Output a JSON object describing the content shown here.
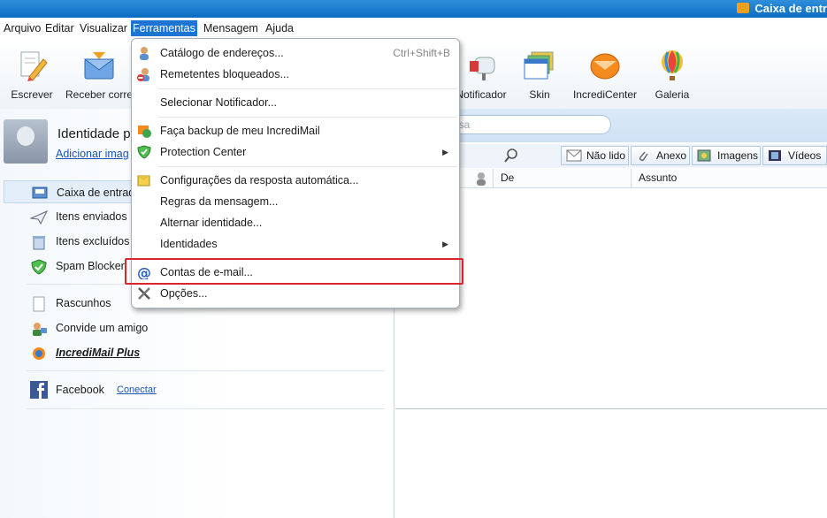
{
  "window": {
    "title": "Caixa de entr"
  },
  "menubar": {
    "items": [
      "Arquivo",
      "Editar",
      "Visualizar",
      "Ferramentas",
      "Mensagem",
      "Ajuda"
    ]
  },
  "toolbar": {
    "buttons": [
      "Escrever",
      "Receber corre",
      "Notificador",
      "Skin",
      "IncrediCenter",
      "Galeria"
    ]
  },
  "sidebar": {
    "identity_name": "Identidade pr",
    "identity_link": "Adicionar imag",
    "folders": [
      "Caixa de entrad",
      "Itens enviados",
      "Itens excluídos",
      "Spam Blocker"
    ],
    "extras": [
      "Rascunhos",
      "Convide um amigo",
      "IncrediMail Plus"
    ],
    "facebook": {
      "label": "Facebook",
      "link": "Conectar"
    }
  },
  "search": {
    "placeholder": "isa"
  },
  "filters": [
    "Não lido",
    "Anexo",
    "Imagens",
    "Vídeos"
  ],
  "columns": {
    "from": "De",
    "subject": "Assunto"
  },
  "dropdown": {
    "items": [
      {
        "label": "Catálogo de endereços...",
        "shortcut": "Ctrl+Shift+B"
      },
      {
        "label": "Remetentes bloqueados..."
      },
      {
        "label": "Selecionar Notificador..."
      },
      {
        "label": "Faça backup de meu IncrediMail"
      },
      {
        "label": "Protection Center",
        "submenu": "▶"
      },
      {
        "label": "Configurações da resposta automática..."
      },
      {
        "label": "Regras da mensagem..."
      },
      {
        "label": "Alternar identidade..."
      },
      {
        "label": "Identidades",
        "submenu": "▶"
      },
      {
        "label": "Contas de e-mail..."
      },
      {
        "label": "Opções..."
      }
    ]
  },
  "colors": {
    "accent": "#1c74d4",
    "highlight": "#d9262d",
    "titlebar": "#0c6cc0"
  }
}
